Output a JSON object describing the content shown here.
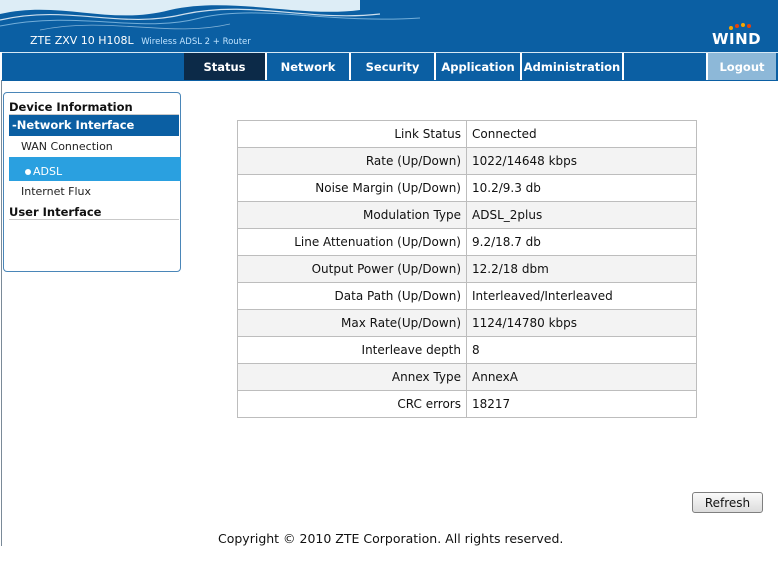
{
  "header": {
    "model": "ZTE ZXV 10 H108L",
    "tagline": "Wireless ADSL 2 + Router",
    "brand": "WIND"
  },
  "nav": {
    "tabs": [
      "Status",
      "Network",
      "Security",
      "Application",
      "Administration"
    ],
    "active": "Status",
    "logout": "Logout"
  },
  "sidebar": {
    "device_information": "Device Information",
    "network_interface": "-Network Interface",
    "wan_connection": "WAN Connection",
    "adsl": "ADSL",
    "internet_flux": "Internet Flux",
    "user_interface": "User Interface"
  },
  "adsl_status": {
    "rows": [
      {
        "label": "Link Status",
        "value": "Connected"
      },
      {
        "label": "Rate (Up/Down)",
        "value": "1022/14648 kbps"
      },
      {
        "label": "Noise Margin (Up/Down)",
        "value": "10.2/9.3 db"
      },
      {
        "label": "Modulation Type",
        "value": "ADSL_2plus"
      },
      {
        "label": "Line Attenuation (Up/Down)",
        "value": "9.2/18.7 db"
      },
      {
        "label": "Output Power (Up/Down)",
        "value": "12.2/18 dbm"
      },
      {
        "label": "Data Path (Up/Down)",
        "value": "Interleaved/Interleaved"
      },
      {
        "label": "Max Rate(Up/Down)",
        "value": "1124/14780 kbps"
      },
      {
        "label": "Interleave depth",
        "value": "8"
      },
      {
        "label": "Annex Type",
        "value": "AnnexA"
      },
      {
        "label": "CRC errors",
        "value": "18217"
      }
    ]
  },
  "refresh_label": "Refresh",
  "footer": "Copyright © 2010 ZTE Corporation. All rights reserved."
}
